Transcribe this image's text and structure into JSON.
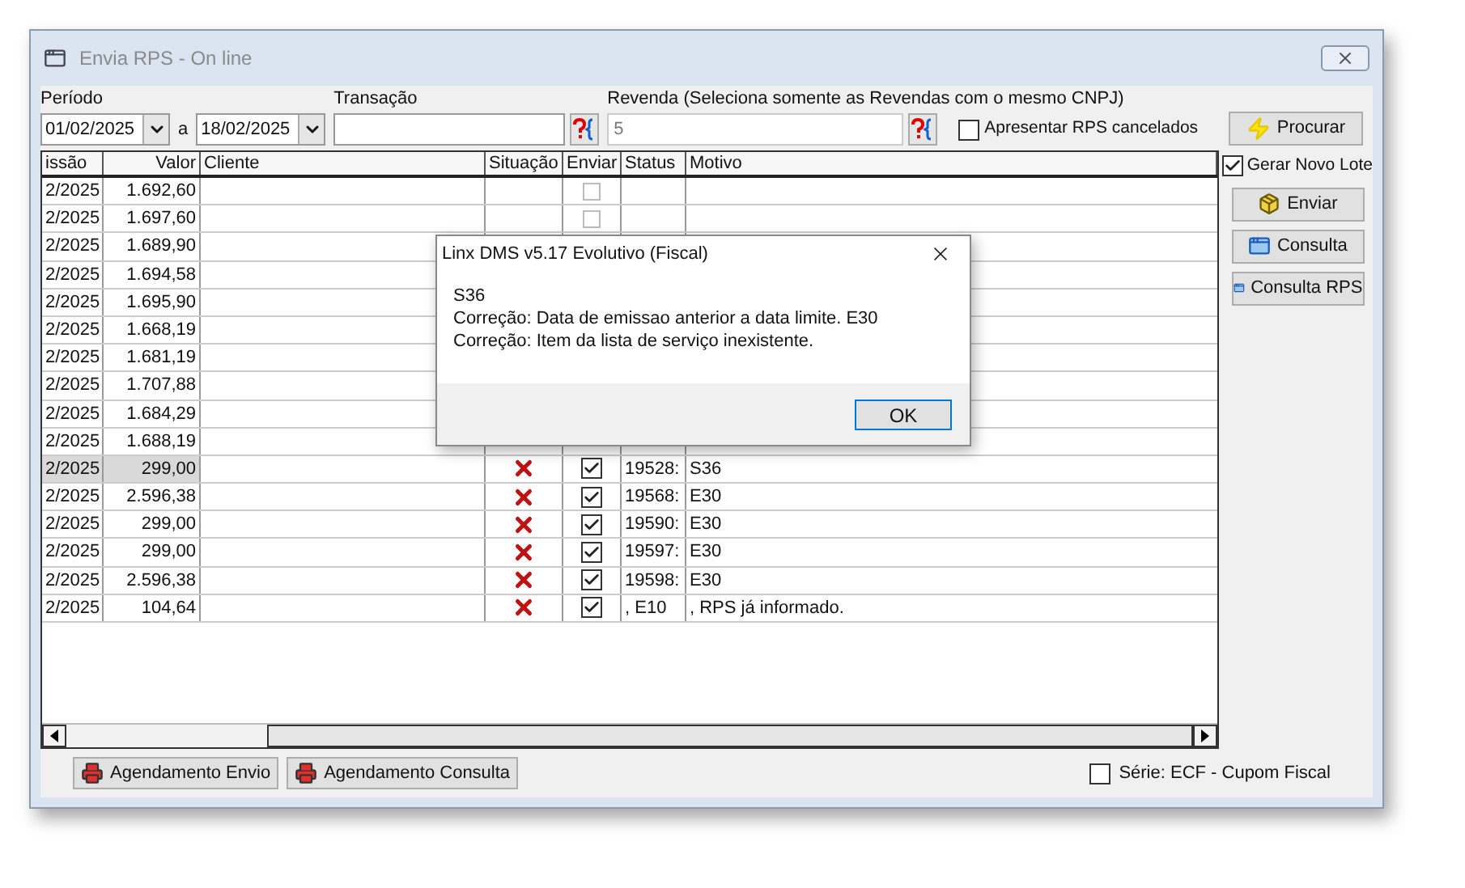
{
  "window": {
    "title": "Envia RPS - On line"
  },
  "filters": {
    "period_label": "Período",
    "date_from": "01/02/2025",
    "range_connector": "a",
    "date_to": "18/02/2025",
    "transaction_label": "Transação",
    "reseller_label": "Revenda (Seleciona somente as Revendas com o mesmo CNPJ)",
    "reseller_value": "5",
    "show_cancelled": {
      "label": "Apresentar RPS cancelados",
      "checked": false
    },
    "search_button": "Procurar"
  },
  "table": {
    "columns": [
      "issão",
      "Valor",
      "Cliente",
      "Situação",
      "Enviar",
      "Status",
      "Motivo"
    ],
    "rows": [
      {
        "date": "2/2025",
        "value": "1.692,60",
        "send": false,
        "selected": false
      },
      {
        "date": "2/2025",
        "value": "1.697,60",
        "send": false,
        "selected": false
      },
      {
        "date": "2/2025",
        "value": "1.689,90",
        "selected": false
      },
      {
        "date": "2/2025",
        "value": "1.694,58",
        "selected": false
      },
      {
        "date": "2/2025",
        "value": "1.695,90",
        "selected": false
      },
      {
        "date": "2/2025",
        "value": "1.668,19",
        "selected": false
      },
      {
        "date": "2/2025",
        "value": "1.681,19",
        "selected": false
      },
      {
        "date": "2/2025",
        "value": "1.707,88",
        "selected": false
      },
      {
        "date": "2/2025",
        "value": "1.684,29",
        "selected": false
      },
      {
        "date": "2/2025",
        "value": "1.688,19",
        "selected": false
      },
      {
        "date": "2/2025",
        "value": "299,00",
        "failed": true,
        "send": true,
        "status": "19528:",
        "reason": "S36",
        "selected": true
      },
      {
        "date": "2/2025",
        "value": "2.596,38",
        "failed": true,
        "send": true,
        "status": "19568:",
        "reason": "E30",
        "selected": false
      },
      {
        "date": "2/2025",
        "value": "299,00",
        "failed": true,
        "send": true,
        "status": "19590:",
        "reason": "E30",
        "selected": false
      },
      {
        "date": "2/2025",
        "value": "299,00",
        "failed": true,
        "send": true,
        "status": "19597:",
        "reason": "E30",
        "selected": false
      },
      {
        "date": "2/2025",
        "value": "2.596,38",
        "failed": true,
        "send": true,
        "status": "19598:",
        "reason": "E30",
        "selected": false
      },
      {
        "date": "2/2025",
        "value": "104,64",
        "failed": true,
        "send": true,
        "status": ", E10",
        "reason": ", RPS já informado.",
        "selected": false
      }
    ]
  },
  "side_panel": {
    "new_batch": {
      "label": "Gerar Novo Lote",
      "checked": true
    },
    "buttons": [
      {
        "kind": "send",
        "label": "Enviar"
      },
      {
        "kind": "query",
        "label": "Consulta"
      },
      {
        "kind": "query",
        "label": "Consulta RPS"
      }
    ]
  },
  "bottom_bar": {
    "buttons": [
      "Agendamento Envio",
      "Agendamento Consulta"
    ],
    "series": {
      "label": "Série: ECF - Cupom Fiscal",
      "checked": false
    }
  },
  "dialog": {
    "title": "Linx DMS v5.17 Evolutivo (Fiscal)",
    "lines": [
      "S36",
      "Correção: Data de emissao anterior a data limite. E30",
      "Correção: Item da lista de serviço inexistente."
    ],
    "ok_button": "OK"
  }
}
